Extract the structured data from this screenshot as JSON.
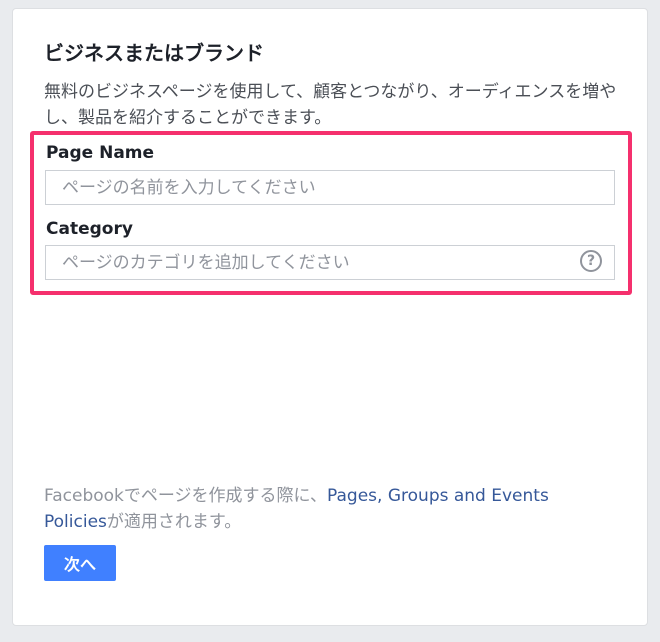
{
  "card": {
    "title": "ビジネスまたはブランド",
    "description": "無料のビジネスページを使用して、顧客とつながり、オーディエンスを増やし、製品を紹介することができます。"
  },
  "form": {
    "page_name": {
      "label": "Page Name",
      "value": "",
      "placeholder": "ページの名前を入力してください"
    },
    "category": {
      "label": "Category",
      "value": "",
      "placeholder": "ページのカテゴリを追加してください",
      "help_icon": "question-circle-icon",
      "help_glyph": "?"
    }
  },
  "policy": {
    "prefix": "Facebookでページを作成する際に、",
    "link_text": "Pages, Groups and Events Policies",
    "suffix": "が適用されます。"
  },
  "actions": {
    "next_label": "次へ"
  },
  "colors": {
    "background": "#e9ebee",
    "highlight_border": "#f5306d",
    "primary_button": "#4080ff",
    "link": "#365899",
    "muted_text": "#90949c"
  }
}
